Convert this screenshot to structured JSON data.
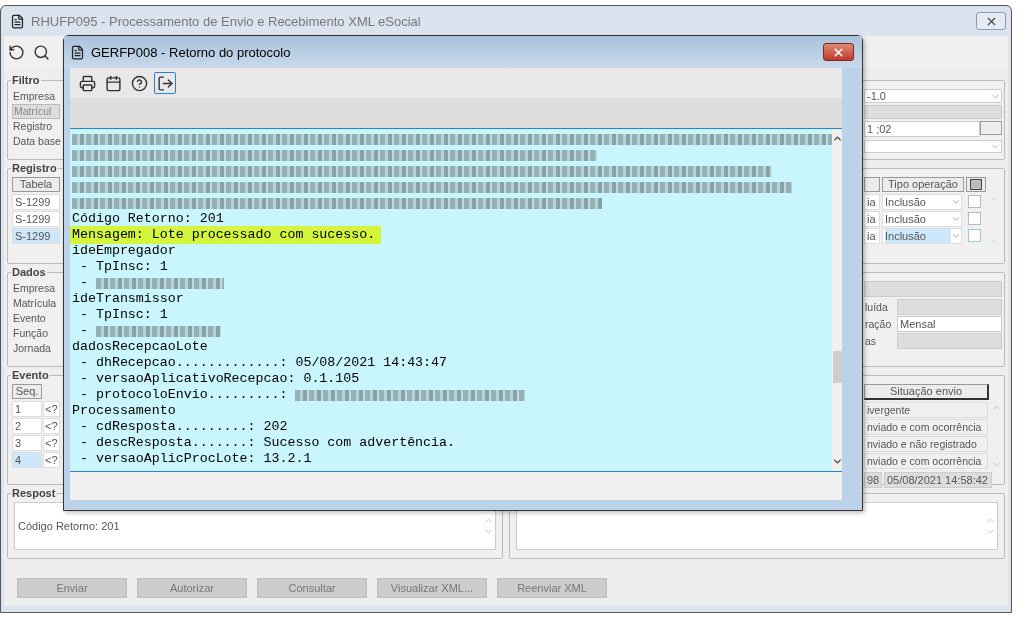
{
  "main_window": {
    "title": "RHUFP095 - Processamento de Envio e Recebimento XML eSocial",
    "active": false
  },
  "filtro": {
    "title": "Filtro",
    "labels": [
      {
        "text": "Empresa",
        "kind": "label"
      },
      {
        "text": "Matrícul",
        "kind": "header"
      },
      {
        "text": "Registro",
        "kind": "label"
      },
      {
        "text": "Data base",
        "kind": "label"
      }
    ],
    "fields": [
      {
        "kind": "dropdown",
        "value": "-1.0"
      },
      {
        "kind": "bar"
      },
      {
        "kind": "picker",
        "value": "1 ;02"
      },
      {
        "kind": "dropdown"
      }
    ]
  },
  "registro": {
    "title": "Registro",
    "column_1": "Tabela",
    "column_3": "Tipo operação",
    "rows": [
      {
        "tabela": "S-1299",
        "column_2": "ia",
        "tipo": "Inclusão",
        "checked": false,
        "selected": false
      },
      {
        "tabela": "S-1299",
        "column_2": "ia",
        "tipo": "Inclusão",
        "checked": false,
        "selected": false
      },
      {
        "tabela": "S-1299",
        "column_2": "ia",
        "tipo": "Inclusão",
        "checked": false,
        "selected": true
      }
    ]
  },
  "dados": {
    "title": "Dados",
    "labels": [
      "Empresa",
      "Matrícula",
      "Evento",
      "Função",
      "Jornada"
    ],
    "fields": [
      {
        "label": "luída"
      },
      {
        "label": "ração",
        "value": "Mensal"
      },
      {
        "label": "as"
      }
    ]
  },
  "evento": {
    "title": "Evento",
    "column_1": "Seq.",
    "column_3": "Situação envio",
    "rows": [
      {
        "seq": "1",
        "column_2": "<?",
        "situacao": "ivergente",
        "selected": false
      },
      {
        "seq": "2",
        "column_2": "<?",
        "situacao": "nviado e com ocorrência",
        "selected": false
      },
      {
        "seq": "3",
        "column_2": "<?",
        "situacao": "nviado e não registrado",
        "selected": false
      },
      {
        "seq": "4",
        "column_2": "<?",
        "situacao": "nviado e com ocorrência",
        "selected": true
      }
    ],
    "footer": [
      "98",
      "05/08/2021 14:58:42"
    ]
  },
  "resposta": {
    "title": "Respost",
    "text": "Código Retorno: 201"
  },
  "buttons": [
    {
      "label": "Enviar",
      "disabled": true
    },
    {
      "label": "Autorizar",
      "disabled": true
    },
    {
      "label": "Consultar",
      "disabled": true
    },
    {
      "label": "Visualizar XML...",
      "disabled": true
    },
    {
      "label": "Reenviar XML",
      "disabled": true
    }
  ],
  "dialog": {
    "title": "GERFP008 - Retorno do protocolo",
    "tools": [
      {
        "kind": "print",
        "focused": false
      },
      {
        "kind": "calendar",
        "focused": false
      },
      {
        "kind": "help",
        "focused": false
      },
      {
        "kind": "exit",
        "focused": true
      }
    ],
    "lines": [
      {
        "kind": "blurred"
      },
      {
        "kind": "blurred"
      },
      {
        "kind": "blurred"
      },
      {
        "kind": "blurred"
      },
      {
        "kind": "blurred"
      },
      {
        "kind": "text",
        "text": "Código Retorno: 201"
      },
      {
        "kind": "highlight",
        "text": "Mensagem: Lote processado com sucesso."
      },
      {
        "kind": "text",
        "text": "ideEmpregador"
      },
      {
        "kind": "text",
        "text": " - TpInsc: 1"
      },
      {
        "kind": "partly_blurred",
        "text": " - "
      },
      {
        "kind": "text",
        "text": "ideTransmissor"
      },
      {
        "kind": "text",
        "text": " - TpInsc: 1"
      },
      {
        "kind": "partly_blurred",
        "text": " - "
      },
      {
        "kind": "text",
        "text": "dadosRecepcaoLote"
      },
      {
        "kind": "text",
        "text": " - dhRecepcao.............: 05/08/2021 14:43:47"
      },
      {
        "kind": "text",
        "text": " - versaoAplicativoRecepcao: 0.1.105"
      },
      {
        "kind": "partly_blurred",
        "text": " - protocoloEnvio.........: "
      },
      {
        "kind": "text",
        "text": "Processamento"
      },
      {
        "kind": "text",
        "text": " - cdResposta.........: 202"
      },
      {
        "kind": "text",
        "text": " - descResposta.......: Sucesso com advertência."
      },
      {
        "kind": "text",
        "text": " - versaoAplicProcLote: 13.2.1"
      }
    ]
  }
}
